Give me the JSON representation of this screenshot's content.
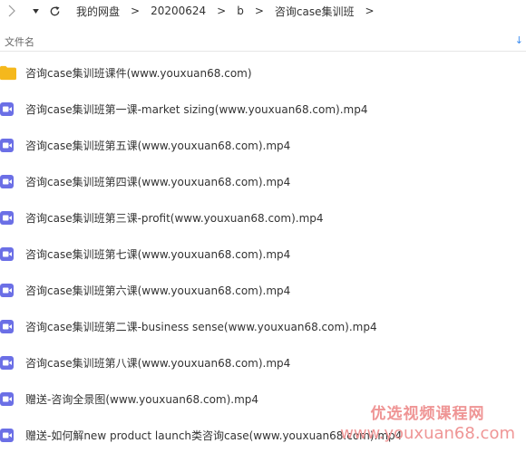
{
  "toolbar": {
    "breadcrumbs": [
      "我的网盘",
      "20200624",
      "b",
      "咨询case集训班"
    ],
    "separator": ">"
  },
  "header": {
    "column_label": "文件名",
    "sort_icon": "sort-arrow-down-icon",
    "sort_glyph": "↓"
  },
  "files": [
    {
      "name": "咨询case集训班课件(www.youxuan68.com)",
      "type": "folder"
    },
    {
      "name": "咨询case集训班第一课-market sizing(www.youxuan68.com).mp4",
      "type": "video"
    },
    {
      "name": "咨询case集训班第五课(www.youxuan68.com).mp4",
      "type": "video"
    },
    {
      "name": "咨询case集训班第四课(www.youxuan68.com).mp4",
      "type": "video"
    },
    {
      "name": "咨询case集训班第三课-profit(www.youxuan68.com).mp4",
      "type": "video"
    },
    {
      "name": "咨询case集训班第七课(www.youxuan68.com).mp4",
      "type": "video"
    },
    {
      "name": "咨询case集训班第六课(www.youxuan68.com).mp4",
      "type": "video"
    },
    {
      "name": "咨询case集训班第二课-business sense(www.youxuan68.com).mp4",
      "type": "video"
    },
    {
      "name": "咨询case集训班第八课(www.youxuan68.com).mp4",
      "type": "video"
    },
    {
      "name": "赠送-咨询全景图(www.youxuan68.com).mp4",
      "type": "video"
    },
    {
      "name": "赠送-如何解new product launch类咨询case(www.youxuan68.com).mp4",
      "type": "video"
    }
  ],
  "watermark": {
    "line1": "优选视频课程网",
    "line2": "www.youxuan68.com"
  },
  "colors": {
    "folder": "#f5b81c",
    "video": "#6b6fe6",
    "accent": "#3b8cf0",
    "watermark": "#ef9595"
  }
}
